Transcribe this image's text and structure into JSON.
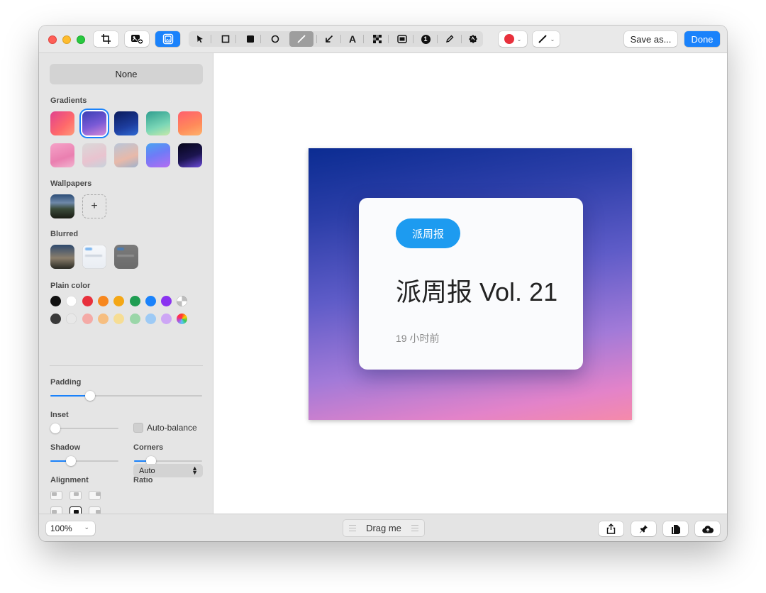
{
  "toolbar": {
    "save_as_label": "Save as...",
    "done_label": "Done",
    "color_accent": "#1a82fb",
    "current_stroke_color": "#e8303c",
    "tools": [
      "crop-icon",
      "add-image-icon",
      "background-icon",
      "pointer-icon",
      "rectangle-outline-icon",
      "rectangle-filled-icon",
      "ellipse-icon",
      "line-icon",
      "arrow-icon",
      "text-icon",
      "pixelate-icon",
      "highlight-icon",
      "counter-icon",
      "pencil-icon",
      "blur-icon"
    ],
    "text_tool_glyph": "A",
    "counter_glyph": "1"
  },
  "sidebar": {
    "none_label": "None",
    "gradients_label": "Gradients",
    "wallpapers_label": "Wallpapers",
    "add_wallpaper_glyph": "+",
    "blurred_label": "Blurred",
    "plain_color_label": "Plain color",
    "padding_label": "Padding",
    "inset_label": "Inset",
    "auto_balance_label": "Auto-balance",
    "shadow_label": "Shadow",
    "corners_label": "Corners",
    "alignment_label": "Alignment",
    "ratio_label": "Ratio",
    "ratio_value": "Auto",
    "padding_value": 0.26,
    "inset_value": 0.0,
    "shadow_value": 0.3,
    "corners_value": 0.25,
    "gradients": [
      "linear-gradient(135deg,#e0418f,#ff6a6a 60%,#ff9a7a)",
      "linear-gradient(160deg,#3b3fb5,#7a5ad6 55%,#d68ad8)",
      "linear-gradient(160deg,#0a1b5c,#1d3d9e 60%,#2f6bd4)",
      "linear-gradient(160deg,#2f9e8f,#7ad6b6 60%,#c8e9a9)",
      "linear-gradient(160deg,#ff5f6d,#ff8a5a 60%,#ffb36b)",
      "linear-gradient(160deg,#f5a3c8,#ea7fb0 60%,#f2b4d0)",
      "linear-gradient(160deg,#d9d9d9,#e9c3cf 60%,#c7d3dc)",
      "linear-gradient(160deg,#b9c6d8,#e8b9a9 60%,#9fb2cc)",
      "linear-gradient(160deg,#4aa3f0,#6e7cf7 45%,#b56cf2)",
      "linear-gradient(160deg,#05051a,#1c1550 55%,#6b4bd8)"
    ],
    "plain_colors_row1": [
      "#111111",
      "#ffffff",
      "#e8303c",
      "#f7871e",
      "#f4a716",
      "#1f9d52",
      "#1a82fb",
      "#8a33f0",
      "transparent"
    ],
    "plain_colors_row2": [
      "#3a3a3a",
      "#e8e8e8",
      "#f4aaa6",
      "#f6be80",
      "#f6dd94",
      "#9ad6a8",
      "#9dcaf5",
      "#cda6f5",
      "rainbow"
    ]
  },
  "canvas": {
    "card_tag": "派周报",
    "card_title": "派周报 Vol. 21",
    "card_time": "19 小时前"
  },
  "bottombar": {
    "zoom_value": "100%",
    "drag_label": "Drag me"
  }
}
